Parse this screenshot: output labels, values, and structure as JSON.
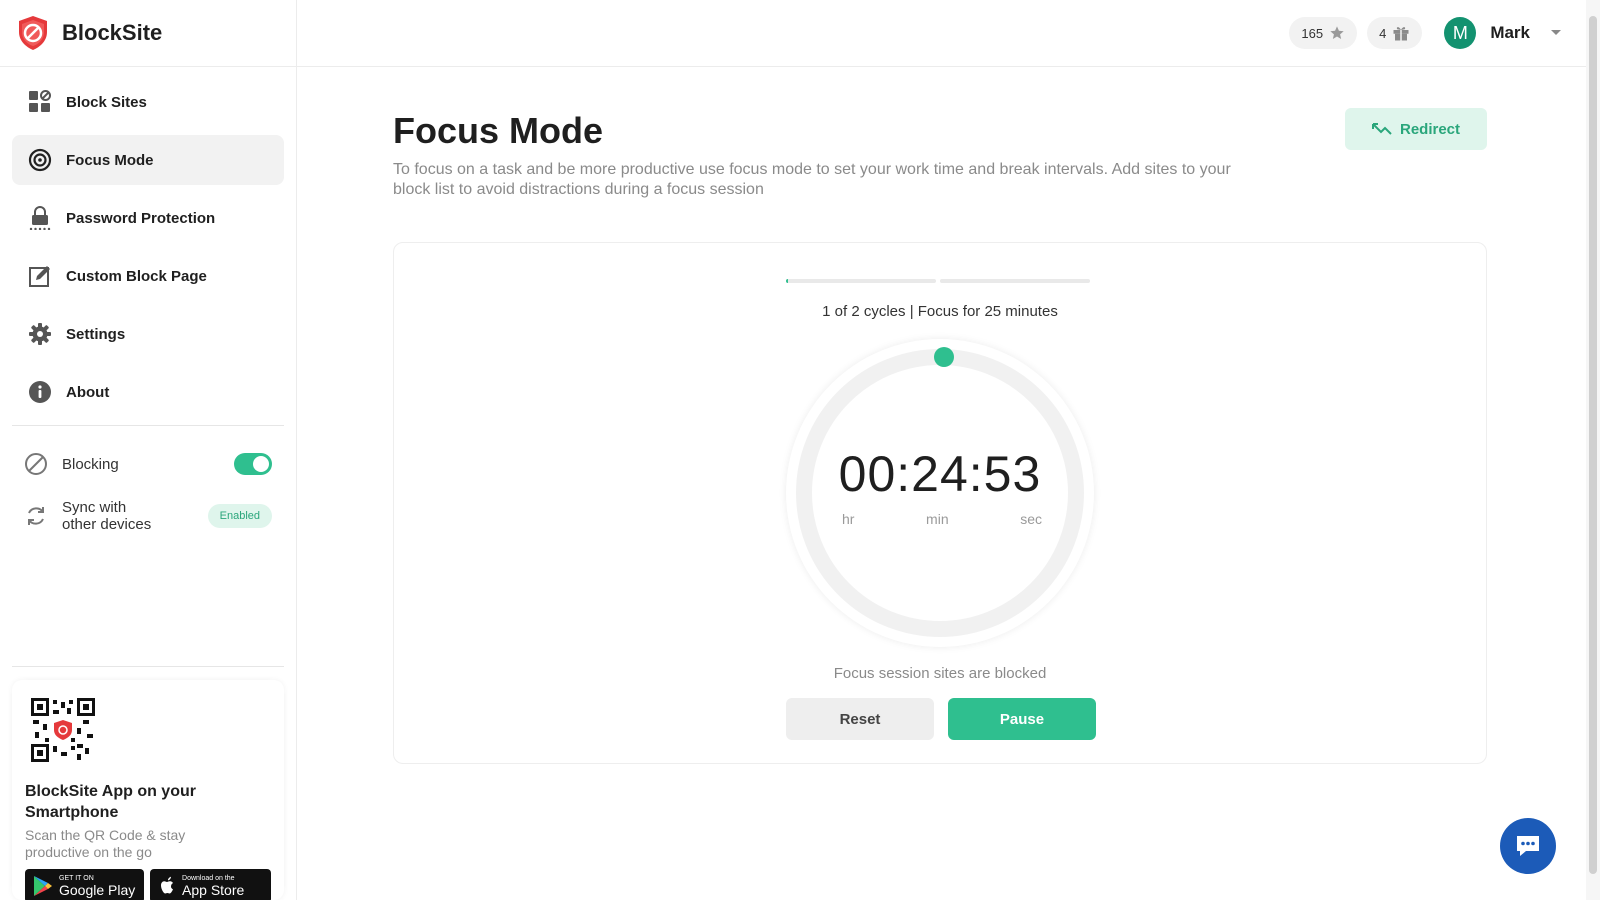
{
  "brand": {
    "name": "BlockSite",
    "color": "#e5393b"
  },
  "sidebar": {
    "items": [
      {
        "label": "Block Sites",
        "icon": "grid-block-icon"
      },
      {
        "label": "Focus Mode",
        "icon": "target-icon",
        "active": true
      },
      {
        "label": "Password Protection",
        "icon": "lock-icon"
      },
      {
        "label": "Custom Block Page",
        "icon": "edit-page-icon"
      },
      {
        "label": "Settings",
        "icon": "gear-icon"
      },
      {
        "label": "About",
        "icon": "info-icon"
      }
    ],
    "toggles": {
      "blocking_label": "Blocking",
      "blocking_on": true,
      "sync_label_1": "Sync with",
      "sync_label_2": "other devices",
      "sync_badge": "Enabled"
    },
    "app_card": {
      "title_1": "BlockSite App on your",
      "title_2": "Smartphone",
      "sub_1": "Scan the QR Code & stay",
      "sub_2": "productive on the go",
      "google_small": "GET IT ON",
      "google_big": "Google Play",
      "apple_small": "Download on the",
      "apple_big": "App Store"
    }
  },
  "header": {
    "points": "165",
    "gifts": "4",
    "avatar_letter": "M",
    "user_name": "Mark"
  },
  "main": {
    "title": "Focus Mode",
    "subtitle_1": "To focus on a task and be more productive use focus mode to set your work time and break intervals. Add sites to your",
    "subtitle_2": "block list to avoid distractions during a focus session",
    "redirect_label": "Redirect",
    "cycle_text": "1 of 2 cycles | Focus for 25 minutes",
    "cycle_progress": [
      0.01,
      0
    ],
    "timer": "00:24:53",
    "units": {
      "hr": "hr",
      "min": "min",
      "sec": "sec"
    },
    "dial_progress": 0.005,
    "blocked_text": "Focus session sites are blocked",
    "reset_label": "Reset",
    "pause_label": "Pause"
  },
  "colors": {
    "accent": "#2fbf8f",
    "chat": "#1c5bb8"
  }
}
